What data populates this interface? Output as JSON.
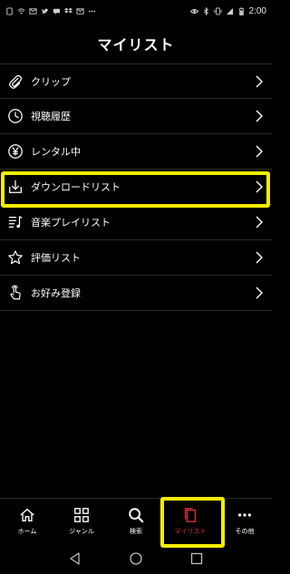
{
  "status_bar": {
    "time": "2:00",
    "left_icons": [
      "sim-icon",
      "wifi-icon",
      "mail-icon",
      "twitter-icon",
      "message-icon",
      "dropbox-icon",
      "mail-icon",
      "more-dots-icon"
    ],
    "right_icons": [
      "eye-icon",
      "bluetooth-icon",
      "vibrate-icon",
      "signal-icon",
      "battery-icon"
    ]
  },
  "page": {
    "title": "マイリスト"
  },
  "menu": {
    "items": [
      {
        "label": "クリップ",
        "icon": "paperclip-icon"
      },
      {
        "label": "視聴履歴",
        "icon": "clock-icon"
      },
      {
        "label": "レンタル中",
        "icon": "yen-icon"
      },
      {
        "label": "ダウンロードリスト",
        "icon": "download-icon",
        "highlighted": true
      },
      {
        "label": "音楽プレイリスト",
        "icon": "playlist-icon"
      },
      {
        "label": "評価リスト",
        "icon": "star-icon"
      },
      {
        "label": "お好み登録",
        "icon": "tap-icon"
      }
    ]
  },
  "tabs": {
    "items": [
      {
        "label": "ホーム",
        "icon": "home-icon"
      },
      {
        "label": "ジャンル",
        "icon": "grid-icon"
      },
      {
        "label": "検索",
        "icon": "search-icon"
      },
      {
        "label": "マイリスト",
        "icon": "mylist-icon",
        "active": true
      },
      {
        "label": "その他",
        "icon": "more-icon"
      }
    ]
  },
  "nav_bar": {
    "buttons": [
      "back-icon",
      "home-circle-icon",
      "recents-icon"
    ]
  },
  "colors": {
    "background": "#000000",
    "active_tab": "#e0293a",
    "highlight": "#f5ed00",
    "divider": "#2b2b2b"
  }
}
